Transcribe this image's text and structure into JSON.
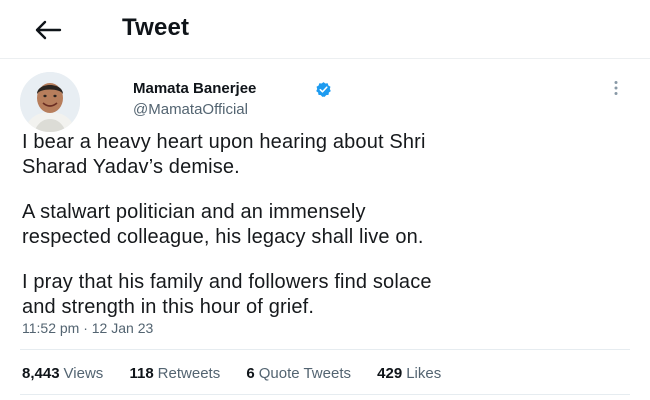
{
  "header": {
    "title": "Tweet"
  },
  "author": {
    "name": "Mamata Banerjee",
    "handle": "@MamataOfficial",
    "verified": true
  },
  "tweet": {
    "paragraphs": [
      [
        "I bear a heavy heart upon hearing about Shri",
        "Sharad Yadav’s demise."
      ],
      [
        "A stalwart politician and an immensely",
        "respected colleague, his legacy shall live on."
      ],
      [
        "I pray that his family and followers find solace",
        "and strength in this hour of grief."
      ]
    ],
    "timestamp": "11:52 pm · 12 Jan 23"
  },
  "stats": [
    {
      "count": "8,443",
      "label": "Views"
    },
    {
      "count": "118",
      "label": "Retweets"
    },
    {
      "count": "6",
      "label": "Quote Tweets"
    },
    {
      "count": "429",
      "label": "Likes"
    }
  ],
  "icons": {
    "back": "arrow-left-icon",
    "verified": "verified-badge-icon",
    "more": "more-vertical-icon"
  },
  "colors": {
    "text": "#0f1419",
    "secondary": "#536471",
    "verified": "#1d9bf0"
  }
}
